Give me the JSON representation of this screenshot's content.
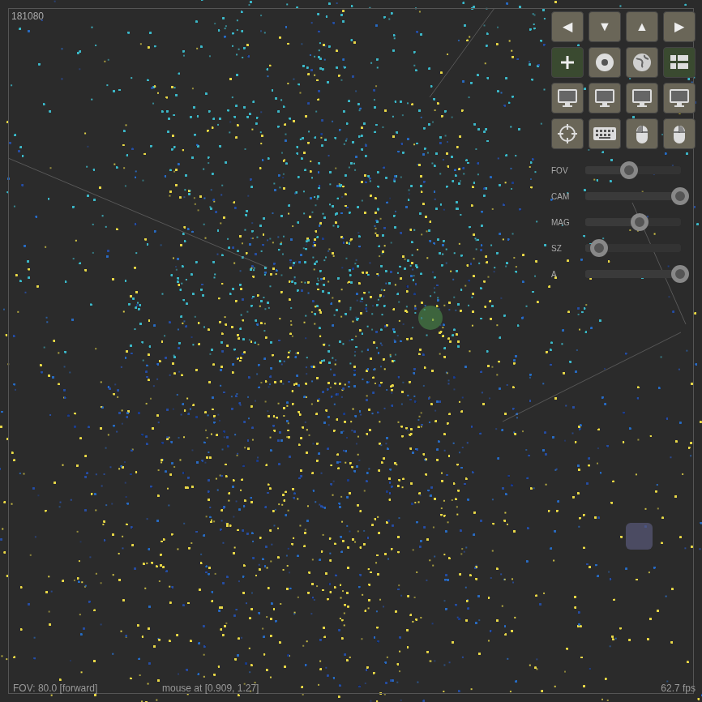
{
  "counter": "181080",
  "buttons": [
    {
      "kind": "glyph",
      "label": "◀",
      "selected": false
    },
    {
      "kind": "glyph",
      "label": "▼",
      "selected": false
    },
    {
      "kind": "glyph",
      "label": "▲",
      "selected": false
    },
    {
      "kind": "glyph",
      "label": "▶",
      "selected": false
    },
    {
      "kind": "plus",
      "selected": true
    },
    {
      "kind": "disc",
      "selected": false
    },
    {
      "kind": "globe",
      "selected": false
    },
    {
      "kind": "list",
      "selected": true
    },
    {
      "kind": "monitor",
      "selected": false
    },
    {
      "kind": "monitor",
      "selected": false
    },
    {
      "kind": "monitor",
      "selected": false
    },
    {
      "kind": "monitor",
      "selected": false
    },
    {
      "kind": "target",
      "selected": false
    },
    {
      "kind": "keyboard",
      "selected": false
    },
    {
      "kind": "mouse-left",
      "selected": false
    },
    {
      "kind": "mouse-right",
      "selected": false
    }
  ],
  "sliders": [
    {
      "label": "FOV",
      "level": 0.47
    },
    {
      "label": "CAM",
      "level": 1.0
    },
    {
      "label": "MAG",
      "level": 0.58
    },
    {
      "label": "SZ",
      "level": 0.15
    },
    {
      "label": "A",
      "level": 1.0
    }
  ],
  "status_bar": {
    "view": "FOV: 80.0 [forward]",
    "mouse": "mouse at [0.909, 1.27]",
    "fps": "62.7 fps"
  }
}
